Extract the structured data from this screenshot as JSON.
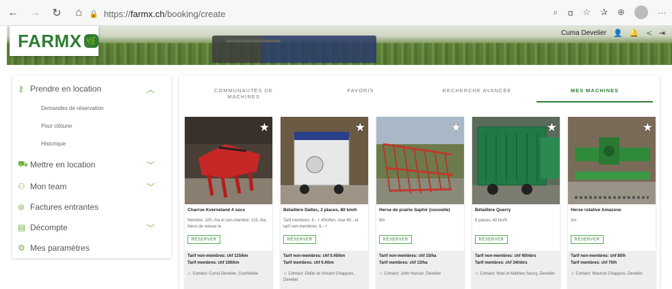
{
  "browser": {
    "url_scheme": "https://",
    "url_host": "farmx.ch",
    "url_path": "/booking/create"
  },
  "header": {
    "logo_text": "FARMX",
    "user_name": "Cuma Develier"
  },
  "sidebar": {
    "items": [
      {
        "label": "Prendre en location",
        "icon": "key-icon",
        "expanded": true
      },
      {
        "label": "Mettre en location",
        "icon": "truck-icon",
        "expanded": false
      },
      {
        "label": "Mon team",
        "icon": "team-icon",
        "expanded": false
      },
      {
        "label": "Factures entrantes",
        "icon": "invoice-icon"
      },
      {
        "label": "Décompte",
        "icon": "statement-icon",
        "expanded": false
      },
      {
        "label": "Mes paramètres",
        "icon": "gear-icon"
      }
    ],
    "sub_items": [
      "Demandes de réservation",
      "Pour clôturer",
      "Historique"
    ]
  },
  "tabs": [
    {
      "label": "COMMUNAUTÉS DE MACHINES",
      "active": false
    },
    {
      "label": "FAVORIS",
      "active": false
    },
    {
      "label": "RECHERCHE AVANCÉE",
      "active": false
    },
    {
      "label": "MES MACHINES",
      "active": true
    }
  ],
  "cards": [
    {
      "title": "Charrue Kverneland 4 socs",
      "desc": "Membre: 100.-/ha et non-membre: 115.-/ha Merci de relever le",
      "reserve": "RÉSERVER",
      "price_non_members": "Tarif non-membres: chf 115/km",
      "price_members": "Tarif membres: chf 100/km",
      "contact": "Contact: Cuma Develier, Courtételle"
    },
    {
      "title": "Bétaillère Daltec, 2 places, 80 km/h",
      "desc": "Tarif membres: 8.- + 40ct/km, max 60.- et tarif non-membres: 9.- +",
      "reserve": "RÉSERVER",
      "price_non_members": "Tarif non-membres: chf 0.45/km",
      "price_members": "Tarif membres: chf 0.4/km",
      "contact": "Contact: Didier et Vincent Chappuis, Develier"
    },
    {
      "title": "Herse de prairie Saphir (nouvelle)",
      "desc": "6m",
      "reserve": "RÉSERVER",
      "price_non_members": "Tarif non-membres: chf 15/ha",
      "price_members": "Tarif membres: chf 13/ha",
      "contact": "Contact: John Hanser, Develier"
    },
    {
      "title": "Bétaillère Querry",
      "desc": "8 places, 40 km/h",
      "reserve": "RÉSERVER",
      "price_non_members": "Tarif non-membres: chf 40/nbrs",
      "price_members": "Tarif membres: chf 34/nbrs",
      "contact": "Contact: Noel et Mathieu Saucy, Develier"
    },
    {
      "title": "Herse rotative Amazone",
      "desc": "3m",
      "reserve": "RÉSERVER",
      "price_non_members": "Tarif non-membres: chf 80/h",
      "price_members": "Tarif membres: chf 70/h",
      "contact": "Contact: Maurice Chappuis, Develier"
    }
  ],
  "colors": {
    "brand_green": "#2e7d32",
    "accent_green": "#6cb33f"
  }
}
